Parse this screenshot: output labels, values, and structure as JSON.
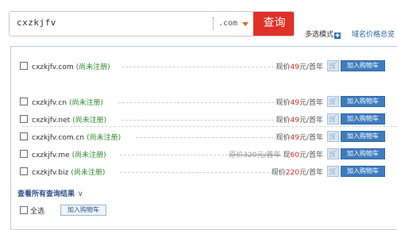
{
  "search": {
    "query": "cxzkjfv",
    "tld": ".com",
    "button_label": "查询"
  },
  "links": {
    "multi_mode": "多选模式",
    "multi_mode_icon": "✚",
    "price_overview": "域名价格总览"
  },
  "results": [
    {
      "domain": "cxzkjfv.com",
      "status": "(尚未注册)",
      "price_prefix": "现价",
      "price": "49",
      "unit": "元/首年",
      "cart_label": "加入购物车"
    },
    {
      "domain": "cxzkjfv.cn",
      "status": "(尚未注册)",
      "price_prefix": "现价",
      "price": "49",
      "unit": "元/首年",
      "cart_label": "加入购物车"
    },
    {
      "domain": "cxzkjfv.net",
      "status": "(尚未注册)",
      "price_prefix": "现价",
      "price": "49",
      "unit": "元/首年",
      "cart_label": "加入购物车"
    },
    {
      "domain": "cxzkjfv.com.cn",
      "status": "(尚未注册)",
      "price_prefix": "现价",
      "price": "49",
      "unit": "元/首年",
      "cart_label": "加入购物车"
    },
    {
      "domain": "cxzkjfv.me",
      "status": "(尚未注册)",
      "orig_price": "原价320元/首年",
      "price_prefix": "现",
      "price": "60",
      "unit": "元/首年",
      "cart_label": "加入购物车"
    },
    {
      "domain": "cxzkjfv.biz",
      "status": "(尚未注册)",
      "price_prefix": "现价",
      "price": "220",
      "unit": "元/首年",
      "cart_label": "加入购物车"
    }
  ],
  "view_all": "查看所有查询结果",
  "view_all_chevron": "∨",
  "footer": {
    "select_all": "全选",
    "add_to_cart": "加入购物车"
  }
}
